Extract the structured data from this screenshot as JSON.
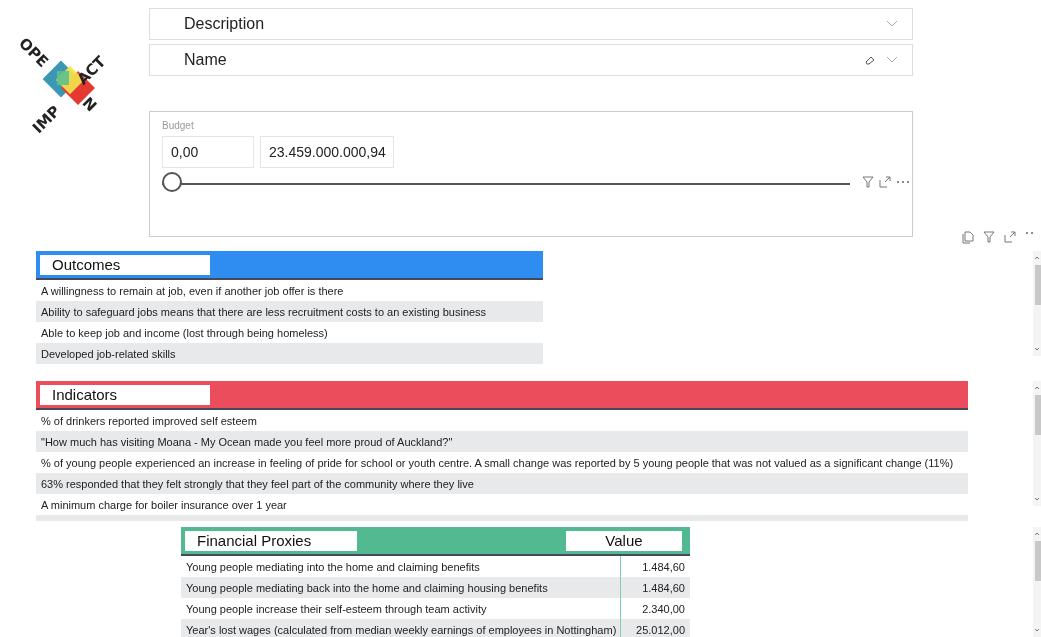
{
  "logo": {
    "parts": [
      "OPE",
      "ACT",
      "IMP",
      "N"
    ]
  },
  "filters": [
    {
      "label": "Description",
      "clearable": false
    },
    {
      "label": "Name",
      "clearable": true
    }
  ],
  "budget": {
    "title": "Budget",
    "min_value": "0,00",
    "max_value": "23.459.000.000,94",
    "level": 0
  },
  "tables": [
    {
      "kind": "list",
      "color": "#2f8cf0",
      "columns": [
        "Outcomes"
      ],
      "rows": [
        [
          "A willingness to remain at job, even if another job offer is there"
        ],
        [
          "Ability to safeguard jobs means that there are less recruitment costs to an existing business"
        ],
        [
          "Able to keep job and income (lost through being homeless)"
        ],
        [
          "Developed job-related skills"
        ]
      ]
    },
    {
      "kind": "list",
      "color": "#ec4d5c",
      "columns": [
        "Indicators"
      ],
      "rows": [
        [
          "% of drinkers reported improved self esteem"
        ],
        [
          "\"How much has visiting Moana - My Ocean made you feel more proud of Auckland?\""
        ],
        [
          "% of young people experienced an increase in feeling of pride for school or youth centre. A small change was reported by 5 young people that was not valued as a significant change (11%)"
        ],
        [
          "63% responded that they felt strongly that they feel part of the community where they live"
        ],
        [
          "A minimum charge for boiler insurance over 1 year"
        ]
      ]
    },
    {
      "kind": "values",
      "color": "#52b990",
      "columns": [
        "Financial Proxies",
        "Value"
      ],
      "rows": [
        [
          "Young people mediating into the home and claiming benefits",
          "1.484,60"
        ],
        [
          "Young people mediating back into the home and claiming housing benefits",
          "1.484,60"
        ],
        [
          "Young people increase their self-esteem through team activity",
          "2.340,00"
        ],
        [
          "Year's lost wages (calculated from median weekly earnings of employees in Nottingham)",
          "25.012,00"
        ]
      ]
    }
  ]
}
